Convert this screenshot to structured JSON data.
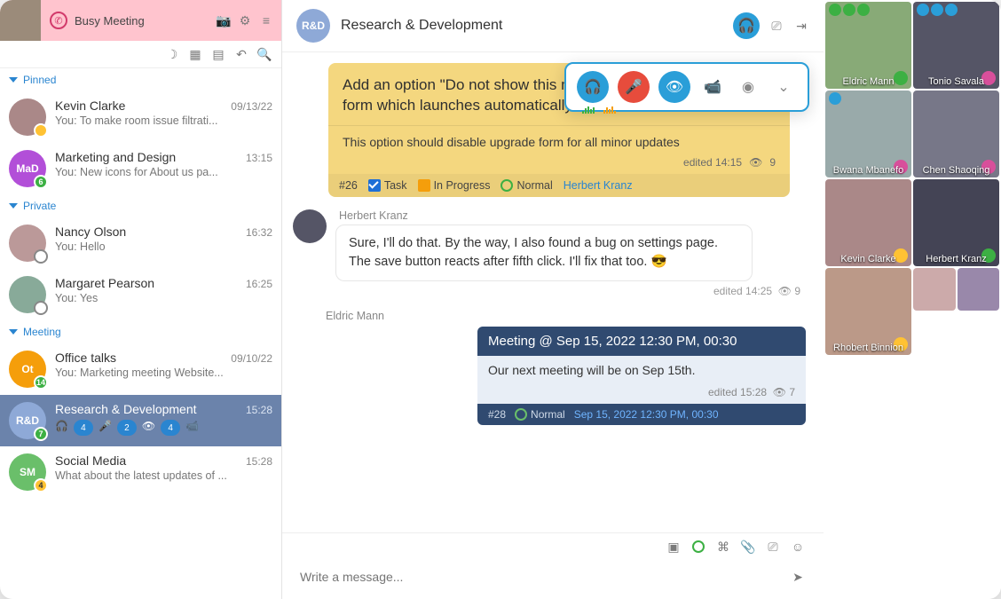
{
  "status": {
    "text": "Busy Meeting"
  },
  "sections": [
    {
      "label": "Pinned"
    },
    {
      "label": "Private"
    },
    {
      "label": "Meeting"
    }
  ],
  "chats": {
    "kevin": {
      "name": "Kevin Clarke",
      "time": "09/13/22",
      "preview": "You: To make room issue filtrati...",
      "badge": ""
    },
    "mad": {
      "name": "Marketing and Design",
      "time": "13:15",
      "preview": "You: New icons for About us pa...",
      "badge": "6",
      "initials": "MaD"
    },
    "nancy": {
      "name": "Nancy Olson",
      "time": "16:32",
      "preview": "You: Hello"
    },
    "margaret": {
      "name": "Margaret Pearson",
      "time": "16:25",
      "preview": "You: Yes"
    },
    "office": {
      "name": "Office talks",
      "time": "09/10/22",
      "preview": "You: Marketing meeting Website...",
      "badge": "14",
      "initials": "Ot"
    },
    "rd": {
      "name": "Research & Development",
      "time": "15:28",
      "badge": "7",
      "initials": "R&D",
      "chips": [
        "4",
        "2",
        "4"
      ]
    },
    "social": {
      "name": "Social Media",
      "time": "15:28",
      "preview": "What about the latest updates of ...",
      "badge": "4",
      "initials": "SM"
    }
  },
  "header": {
    "title": "Research & Development",
    "initials": "R&D"
  },
  "task": {
    "title": "Add an option \"Do not show this message again\" on the upgrade form which launches automatically",
    "body": "This option should disable upgrade form for all minor updates",
    "edited": "edited 14:15",
    "views": "9",
    "id": "#26",
    "type": "Task",
    "status": "In Progress",
    "priority": "Normal",
    "assignee": "Herbert Kranz"
  },
  "msg1": {
    "sender": "Herbert Kranz",
    "text": "Sure, I'll do that. By the way, I also found a bug on settings page. The save button reacts after fifth click. I'll fix that too. 😎",
    "edited": "edited 14:25",
    "views": "9"
  },
  "msg2_sender": "Eldric Mann",
  "meeting": {
    "title": "Meeting @ Sep 15, 2022 12:30 PM, 00:30",
    "body": "Our next meeting will be on Sep 15th.",
    "edited": "edited 15:28",
    "views": "7",
    "id": "#28",
    "priority": "Normal",
    "link": "Sep 15, 2022 12:30 PM, 00:30"
  },
  "composer": {
    "placeholder": "Write a message..."
  },
  "participants": [
    {
      "name": "Eldric Mann"
    },
    {
      "name": "Tonio Savala"
    },
    {
      "name": "Bwana Mbanefo"
    },
    {
      "name": "Chen Shaoqing"
    },
    {
      "name": "Kevin Clarke"
    },
    {
      "name": "Herbert Kranz"
    },
    {
      "name": "Rhobert Binnion"
    }
  ]
}
